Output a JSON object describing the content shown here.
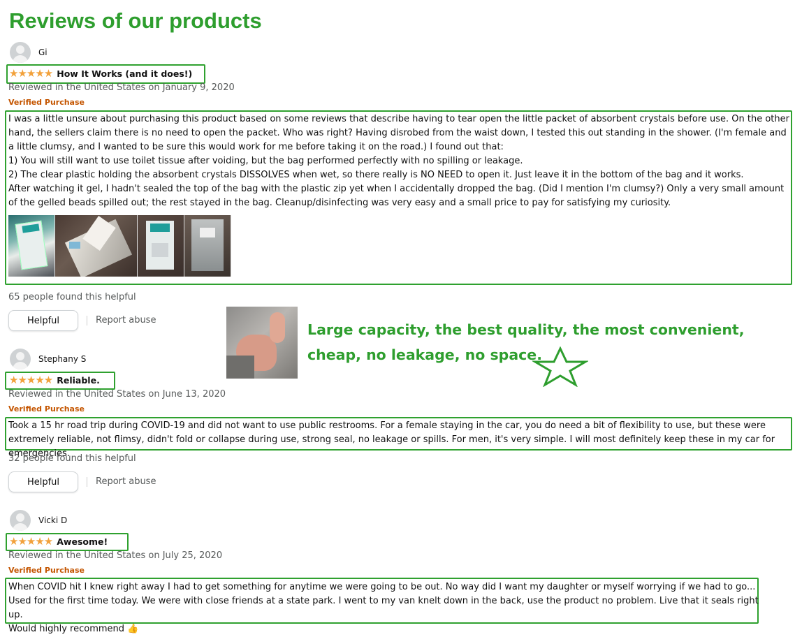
{
  "page_title": "Reviews of our products",
  "reviews": [
    {
      "reviewer": "Gi",
      "stars": "★★★★★",
      "title": "How It Works (and it does!)",
      "date": "Reviewed in the United States on January 9, 2020",
      "verified": "Verified Purchase",
      "text": [
        "I was a little unsure about purchasing this product based on some reviews that describe having to tear open the little packet of absorbent crystals before use. On the other hand, the sellers claim there is no need to open the packet. Who was right? Having disrobed from the waist down, I tested this out standing in the shower. (I'm female and a little clumsy, and I wanted to be sure this would work for me before taking it on the road.) I found out that:",
        "1) You will still want to use toilet tissue after voiding, but the bag performed perfectly with no spilling or leakage.",
        "2) The clear plastic holding the absorbent crystals DISSOLVES when wet, so there really is NO NEED to open it. Just leave it in the bottom of the bag and it works.",
        "After watching it gel, I hadn't sealed the top of the bag with the plastic zip yet when I accidentally dropped the bag. (Did I mention I'm clumsy?) Only a very small amount of the gelled beads spilled out; the rest stayed in the bag. Cleanup/disinfecting was very easy and a small price to pay for satisfying my curiosity."
      ],
      "helpful_count": "65 people found this helpful",
      "helpful_label": "Helpful",
      "report_label": "Report abuse"
    },
    {
      "reviewer": "Stephany S",
      "stars": "★★★★★",
      "title": "Reliable.",
      "date": "Reviewed in the United States on June 13, 2020",
      "verified": "Verified Purchase",
      "text": [
        "Took a 15 hr road trip during COVID-19 and did not want to use public restrooms. For a female staying in the car, you do need a bit of flexibility to use, but these were extremely reliable, not flimsy, didn't fold or collapse during use, strong seal, no leakage or spills. For men, it's very simple. I will most definitely keep these in my car for emergencies."
      ],
      "helpful_count": "32 people found this helpful",
      "helpful_label": "Helpful",
      "report_label": "Report abuse"
    },
    {
      "reviewer": "Vicki D",
      "stars": "★★★★★",
      "title": "Awesome!",
      "date": "Reviewed in the United States on July 25, 2020",
      "verified": "Verified Purchase",
      "text": [
        "When COVID hit I knew right away I had to get something for anytime we were going to be out. No way did I want my daughter or myself worrying if we had to go...",
        "Used for the first time today. We were with close friends at a state park. I went to my van knelt down in the back, use the product no problem. Live that it seals right up.",
        "Would highly recommend"
      ],
      "thumbs_up_emoji": "👍"
    }
  ],
  "promo": {
    "line1": "Large capacity, the best quality, the most convenient,",
    "line2": "cheap, no leakage, no space."
  },
  "colors": {
    "accent_green": "#2e9e2e",
    "star_orange": "#f2a13b",
    "verified_orange": "#c45500",
    "meta_gray": "#565959"
  },
  "icons": [
    "avatar-icon",
    "star-icon",
    "thumbs-up-icon",
    "star-outline-icon"
  ]
}
